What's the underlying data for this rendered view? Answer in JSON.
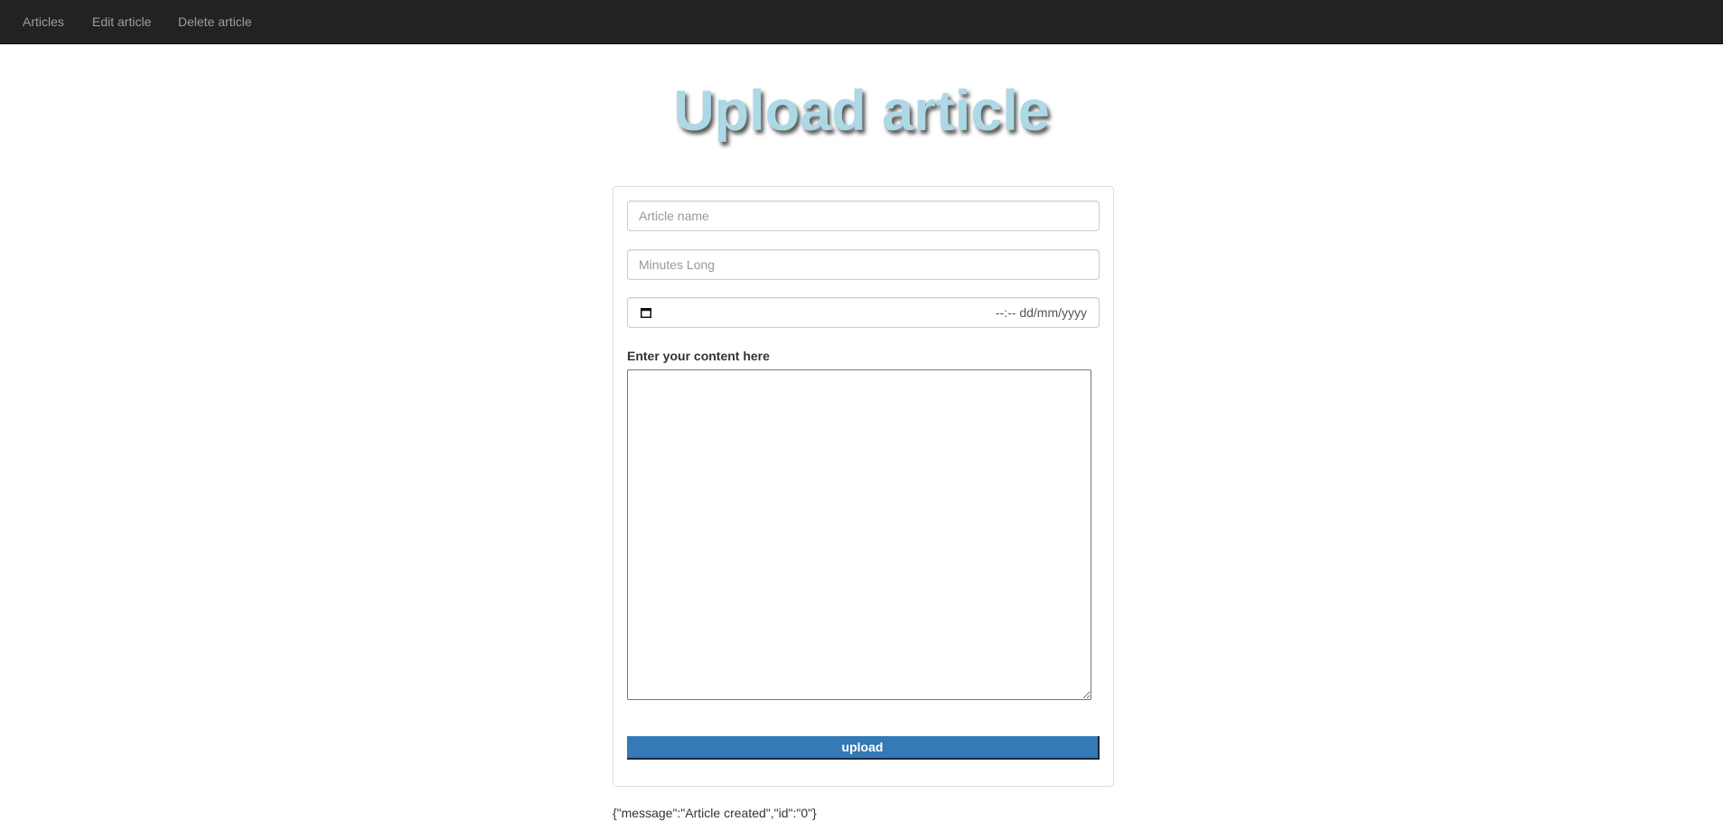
{
  "nav": {
    "items": [
      {
        "label": "Articles"
      },
      {
        "label": "Edit article"
      },
      {
        "label": "Delete article"
      }
    ]
  },
  "page": {
    "title": "Upload article"
  },
  "form": {
    "article_name": {
      "placeholder": "Article name",
      "value": ""
    },
    "minutes_long": {
      "placeholder": "Minutes Long",
      "value": ""
    },
    "datetime": {
      "display": "--:-- dd/mm/yyyy",
      "icon": "calendar-icon"
    },
    "content_label": "Enter your content here",
    "content_value": "",
    "upload_label": "upload"
  },
  "response": {
    "text": "{\"message\":\"Article created\",\"id\":\"0\"}"
  },
  "colors": {
    "navbar": "#222222",
    "title": "#add8e6",
    "button": "#337ab7"
  }
}
